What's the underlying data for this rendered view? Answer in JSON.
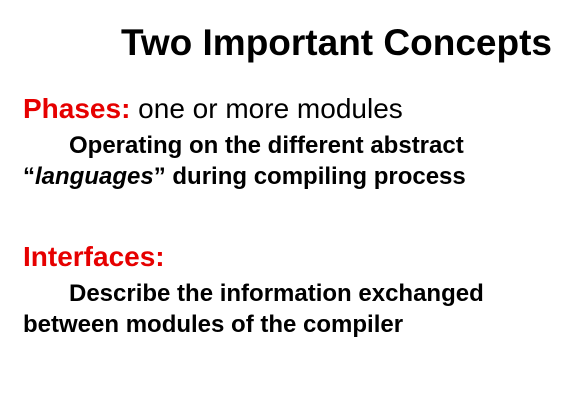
{
  "title": "Two Important Concepts",
  "phases": {
    "label": "Phases:",
    "summary": " one or more modules",
    "line1": "Operating on the different abstract",
    "line2_open_quote": "“",
    "line2_emphasis": "languages",
    "line2_rest": "” during compiling process"
  },
  "interfaces": {
    "label": "Interfaces:",
    "line1": "Describe the information exchanged",
    "line2": "between modules of the compiler"
  },
  "colors": {
    "heading_accent": "#e60000",
    "text": "#000000",
    "background": "#ffffff"
  }
}
